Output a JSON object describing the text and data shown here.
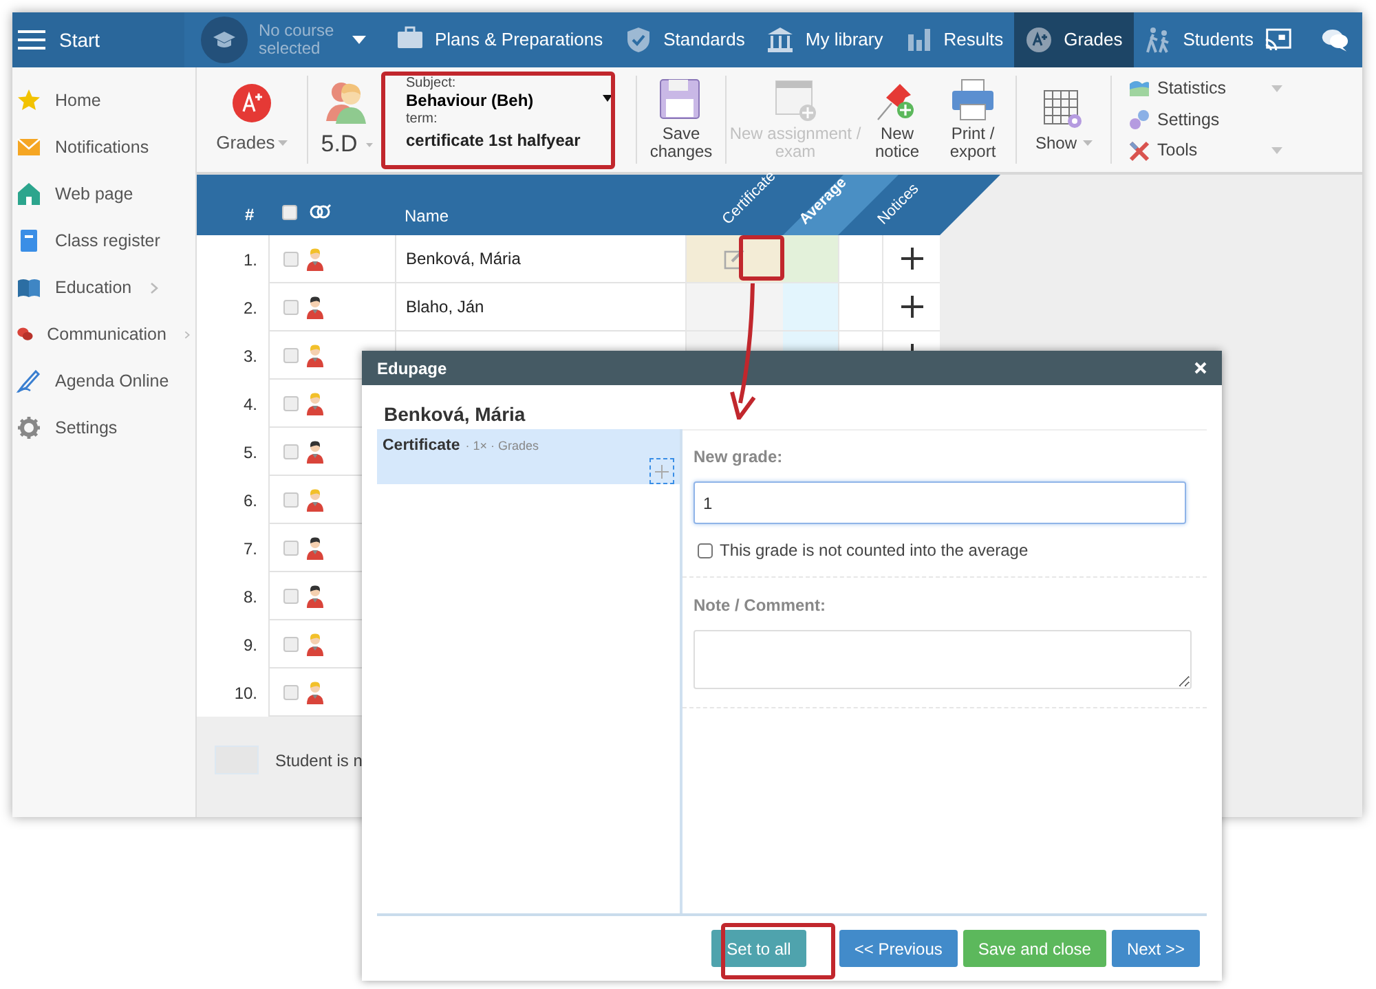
{
  "topbar": {
    "start_label": "Start",
    "course": "No course selected",
    "nav": [
      {
        "label": "Plans & Preparations",
        "selected": false
      },
      {
        "label": "Standards",
        "selected": false
      },
      {
        "label": "My library",
        "selected": false
      },
      {
        "label": "Results",
        "selected": false
      },
      {
        "label": "Grades",
        "selected": true
      },
      {
        "label": "Students",
        "selected": false
      }
    ]
  },
  "sidebar": {
    "items": [
      {
        "label": "Home",
        "has_submenu": false
      },
      {
        "label": "Notifications",
        "has_submenu": false
      },
      {
        "label": "Web page",
        "has_submenu": false
      },
      {
        "label": "Class register",
        "has_submenu": false
      },
      {
        "label": "Education",
        "has_submenu": true
      },
      {
        "label": "Communication",
        "has_submenu": true
      },
      {
        "label": "Agenda Online",
        "has_submenu": false
      },
      {
        "label": "Settings",
        "has_submenu": false
      }
    ]
  },
  "toolbar": {
    "grades_label": "Grades",
    "class_label": "5.D",
    "subject": {
      "label": "Subject:",
      "value": "Behaviour (Beh)",
      "term_label": "term:",
      "term": "certificate 1st halfyear"
    },
    "buttons": [
      {
        "label": "Save changes",
        "disabled": false
      },
      {
        "label": "New assignment / exam",
        "disabled": true
      },
      {
        "label": "New notice",
        "disabled": false
      },
      {
        "label": "Print / export",
        "disabled": false
      },
      {
        "label": "Show",
        "disabled": false
      }
    ],
    "menu": [
      {
        "label": "Statistics",
        "has_caret": true
      },
      {
        "label": "Settings",
        "has_caret": false
      },
      {
        "label": "Tools",
        "has_caret": true
      }
    ]
  },
  "table": {
    "columns": [
      "#",
      "Name",
      "Certificate",
      "Average",
      "Notices"
    ],
    "select_all_checked": false,
    "rows": [
      {
        "number": "1.",
        "name": "Benková, Mária",
        "kind": "girl",
        "checked": false,
        "selected": true
      },
      {
        "number": "2.",
        "name": "Blaho, Ján",
        "kind": "boy",
        "checked": false,
        "selected": false
      },
      {
        "number": "3.",
        "kind": "girl",
        "checked": false,
        "selected": false
      },
      {
        "number": "4.",
        "kind": "girl",
        "checked": false
      },
      {
        "number": "5.",
        "kind": "boy",
        "checked": false
      },
      {
        "number": "6.",
        "kind": "girl",
        "checked": false
      },
      {
        "number": "7.",
        "kind": "boy",
        "checked": false
      },
      {
        "number": "8.",
        "kind": "boy",
        "checked": false
      },
      {
        "number": "9.",
        "kind": "girl",
        "checked": false
      },
      {
        "number": "10.",
        "kind": "girl",
        "checked": false
      }
    ]
  },
  "legend": "Student is n",
  "dialog": {
    "title": "Edupage",
    "student": "Benková, Mária",
    "items": [
      {
        "label": "Certificate",
        "meta": "· 1× · Grades",
        "selected": true
      }
    ],
    "new_grade_label": "New grade:",
    "new_grade_value": "1",
    "exclude_label": "This grade is not counted into the average",
    "exclude_checked": false,
    "note_label": "Note / Comment:",
    "buttons": [
      {
        "label": "Set to all",
        "kind": "neutral"
      },
      {
        "label": "<< Previous",
        "kind": "primary"
      },
      {
        "label": "Save and close",
        "kind": "success"
      },
      {
        "label": "Next >>",
        "kind": "primary"
      }
    ]
  }
}
